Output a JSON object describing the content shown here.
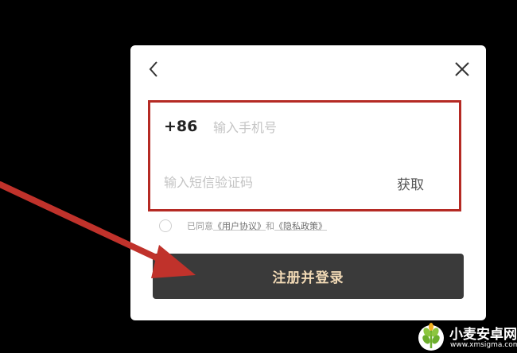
{
  "dialog": {
    "back_icon": "chevron-left-icon",
    "close_icon": "close-icon",
    "phone": {
      "country_code": "+86",
      "placeholder": "输入手机号",
      "value": ""
    },
    "code": {
      "placeholder": "输入短信验证码",
      "value": "",
      "get_code_label": "获取"
    },
    "agreement": {
      "checked": false,
      "prefix": "已同意",
      "user_agreement": "《用户协议》",
      "conjunction": "和",
      "privacy_policy": "《隐私政策》"
    },
    "submit_label": "注册并登录"
  },
  "annotation": {
    "highlight_color": "#b52a24",
    "arrow_color": "#c0322b"
  },
  "watermark": {
    "name": "小麦安卓网",
    "url": "www.xmsigma.com"
  },
  "colors": {
    "background": "#000000",
    "dialog": "#ffffff",
    "button_bg": "#3a3a3a",
    "button_text": "#f1d9b5"
  }
}
